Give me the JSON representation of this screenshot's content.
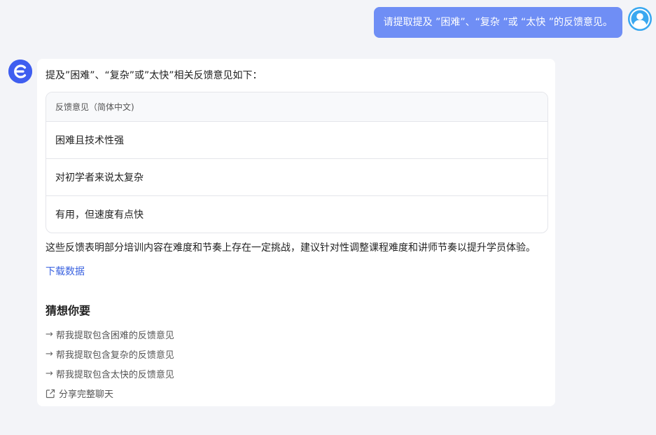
{
  "user_message": "请提取提及 ”困难”、“复杂 ”或 “太快 ”的反馈意见。",
  "assistant": {
    "intro": "提及”困难”、“复杂”或”太快”相关反馈意见如下：",
    "table": {
      "header": "反馈意见（简体中文)",
      "rows": [
        "困难且技术性强",
        "对初学者来说太复杂",
        "有用，但速度有点快"
      ]
    },
    "summary": "这些反馈表明部分培训内容在难度和节奏上存在一定挑战，建议针对性调整课程难度和讲师节奏以提升学员体验。",
    "download_label": "下载数据",
    "guess": {
      "title": "猜想你要",
      "suggestions": [
        "帮我提取包含困难的反馈意见",
        "帮我提取包含复杂的反馈意见",
        "帮我提取包含太快的反馈意见"
      ],
      "arrow": "→"
    },
    "share_label": "分享完整聊天"
  },
  "colors": {
    "background": "#f3f4f8",
    "user_bubble": "#6f8ef5",
    "bot_avatar": "#3f5ef0",
    "link": "#3b63e0"
  },
  "icons": {
    "user_avatar": "user-avatar-icon",
    "bot_avatar": "bot-logo-icon",
    "share": "share-icon"
  }
}
